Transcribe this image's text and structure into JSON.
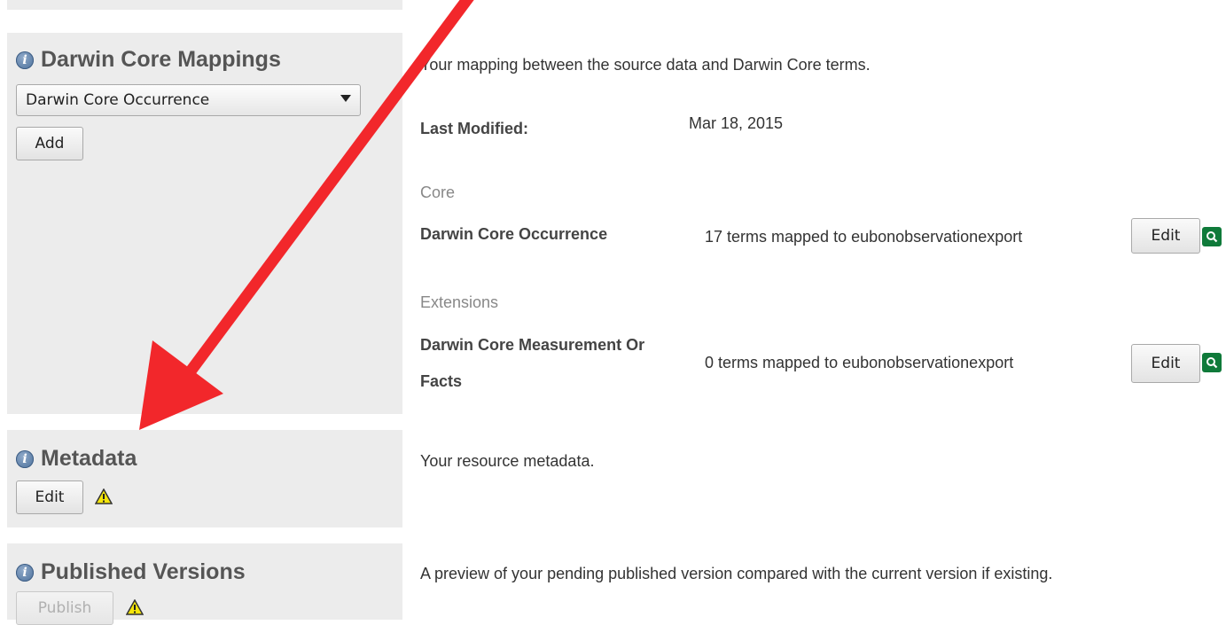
{
  "mappings": {
    "title": "Darwin Core Mappings",
    "select_value": "Darwin Core Occurrence",
    "add_label": "Add",
    "description": "Your mapping between the source data and Darwin Core terms.",
    "last_modified_label": "Last Modified:",
    "last_modified_value": "Mar 18, 2015",
    "core_heading": "Core",
    "extensions_heading": "Extensions",
    "core_item": {
      "name": "Darwin Core Occurrence",
      "summary": "17 terms mapped to eubonobservationexport",
      "edit_label": "Edit"
    },
    "extension_item": {
      "name_line1": "Darwin Core Measurement Or",
      "name_line2": "Facts",
      "summary": "0 terms mapped to eubonobservationexport",
      "edit_label": "Edit"
    }
  },
  "metadata": {
    "title": "Metadata",
    "edit_label": "Edit",
    "description": "Your resource metadata."
  },
  "published": {
    "title": "Published Versions",
    "publish_label": "Publish",
    "description": "A preview of your pending published version compared with the current version if existing."
  },
  "colors": {
    "panel_bg": "#ececec",
    "arrow": "#f2272b",
    "preview_icon": "#0f7a3a",
    "warning": "#f5e50a"
  }
}
